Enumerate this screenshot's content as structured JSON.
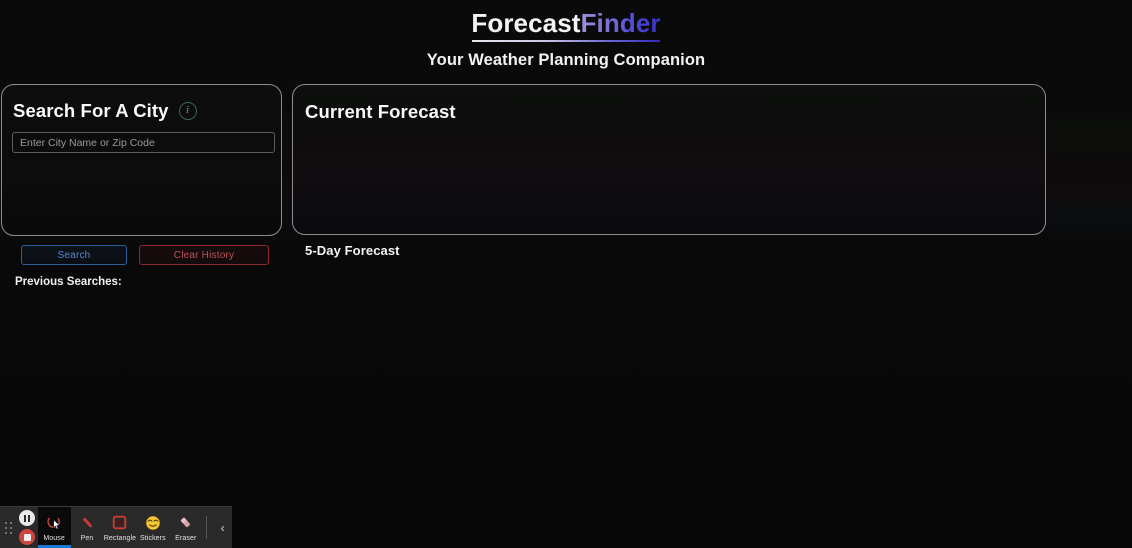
{
  "header": {
    "title_first": "Forecast",
    "title_second": "Finder",
    "subtitle": "Your Weather Planning Companion"
  },
  "search_panel": {
    "heading": "Search For A City",
    "info_icon_glyph": "i",
    "input": {
      "placeholder": "Enter City Name or Zip Code",
      "value": ""
    },
    "search_label": "Search",
    "clear_history_label": "Clear History",
    "previous_searches_label": "Previous Searches:",
    "previous_searches": []
  },
  "forecast_panel": {
    "heading": "Current Forecast",
    "content": ""
  },
  "five_day": {
    "heading": "5-Day Forecast",
    "days": []
  },
  "recorder_toolbar": {
    "pause_icon": "pause-icon",
    "stop_icon": "stop-icon",
    "collapse_glyph": "‹",
    "tools": [
      {
        "label": "Mouse",
        "icon": "mouse-cursor-icon",
        "selected": true
      },
      {
        "label": "Pen",
        "icon": "pen-icon",
        "selected": false
      },
      {
        "label": "Rectangle",
        "icon": "rectangle-icon",
        "selected": false
      },
      {
        "label": "Stickers",
        "icon": "sticker-smiley-icon",
        "selected": false
      },
      {
        "label": "Eraser",
        "icon": "eraser-icon",
        "selected": false
      }
    ]
  },
  "colors": {
    "accent_blue": "#1878d4",
    "title_purple": "#7a6fd6",
    "search_button_border": "#2e5d9e",
    "clear_button_border": "#8c2730",
    "record_red": "#d0443f",
    "info_teal": "#6f9b96",
    "panel_border": "#8d8d8d"
  }
}
